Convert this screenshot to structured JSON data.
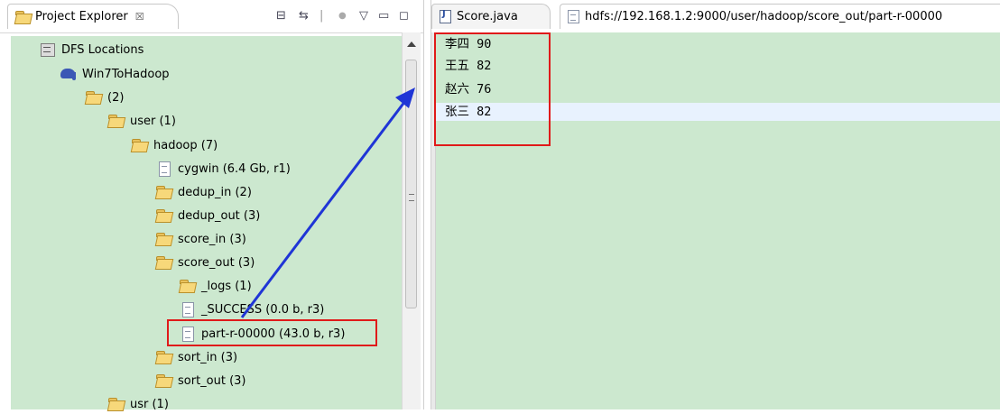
{
  "project_explorer": {
    "title": "Project Explorer",
    "close_glyph": "☒",
    "toolbar": {
      "collapse_all": "⊟",
      "link_editor": "⇆",
      "separator": "|",
      "view_menu": "▽",
      "minimize": "▭",
      "maximize": "◻"
    }
  },
  "tree": [
    {
      "label": "DFS Locations",
      "icon": "dfs-location-icon"
    },
    {
      "label": "Win7ToHadoop",
      "icon": "hadoop-elephant-icon"
    },
    {
      "label": "(2)",
      "icon": "folder-icon"
    },
    {
      "label": "user (1)",
      "icon": "folder-icon"
    },
    {
      "label": "hadoop (7)",
      "icon": "folder-icon"
    },
    {
      "label": "cygwin (6.4 Gb, r1)",
      "icon": "file-icon"
    },
    {
      "label": "dedup_in (2)",
      "icon": "folder-icon"
    },
    {
      "label": "dedup_out (3)",
      "icon": "folder-icon"
    },
    {
      "label": "score_in (3)",
      "icon": "folder-icon"
    },
    {
      "label": "score_out (3)",
      "icon": "folder-icon"
    },
    {
      "label": "_logs (1)",
      "icon": "folder-icon"
    },
    {
      "label": "_SUCCESS (0.0 b, r3)",
      "icon": "file-icon"
    },
    {
      "label": "part-r-00000 (43.0 b, r3)",
      "icon": "file-icon"
    },
    {
      "label": "sort_in (3)",
      "icon": "folder-icon"
    },
    {
      "label": "sort_out (3)",
      "icon": "folder-icon"
    },
    {
      "label": "usr (1)",
      "icon": "folder-icon"
    }
  ],
  "editor_tabs": [
    {
      "label": "Score.java",
      "icon": "java-file-icon"
    },
    {
      "label": "hdfs://192.168.1.2:9000/user/hadoop/score_out/part-r-00000",
      "icon": "text-file-icon"
    }
  ],
  "editor": {
    "lines": [
      "李四 90",
      "王五 82",
      "赵六 76",
      "张三 82"
    ]
  },
  "colors": {
    "tree_background": "#cce8cf",
    "editor_background": "#cce8cf",
    "annotation_box": "#e01a1a",
    "annotation_arrow": "#1f35d6",
    "current_line": "#e8f2fe"
  }
}
